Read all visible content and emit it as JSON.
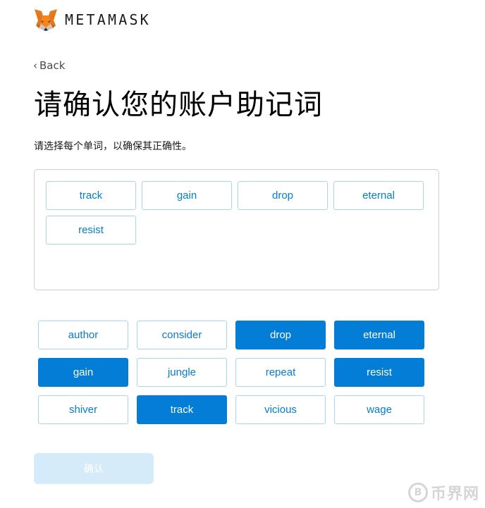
{
  "header": {
    "brand": "METAMASK",
    "logo_icon": "metamask-fox-icon"
  },
  "nav": {
    "back_label": "Back"
  },
  "title": "请确认您的账户助记词",
  "subtitle": "请选择每个单词，以确保其正确性。",
  "selected_words": [
    "track",
    "gain",
    "drop",
    "eternal",
    "resist"
  ],
  "word_bank": [
    {
      "word": "author",
      "selected": false
    },
    {
      "word": "consider",
      "selected": false
    },
    {
      "word": "drop",
      "selected": true
    },
    {
      "word": "eternal",
      "selected": true
    },
    {
      "word": "gain",
      "selected": true
    },
    {
      "word": "jungle",
      "selected": false
    },
    {
      "word": "repeat",
      "selected": false
    },
    {
      "word": "resist",
      "selected": true
    },
    {
      "word": "shiver",
      "selected": false
    },
    {
      "word": "track",
      "selected": true
    },
    {
      "word": "vicious",
      "selected": false
    },
    {
      "word": "wage",
      "selected": false
    }
  ],
  "confirm_label": "确认",
  "watermark": {
    "text": "币界网",
    "icon_glyph": "B"
  },
  "colors": {
    "accent": "#037dd6",
    "outline": "#a7d5f2",
    "confirm_disabled": "#d6ebfa"
  }
}
